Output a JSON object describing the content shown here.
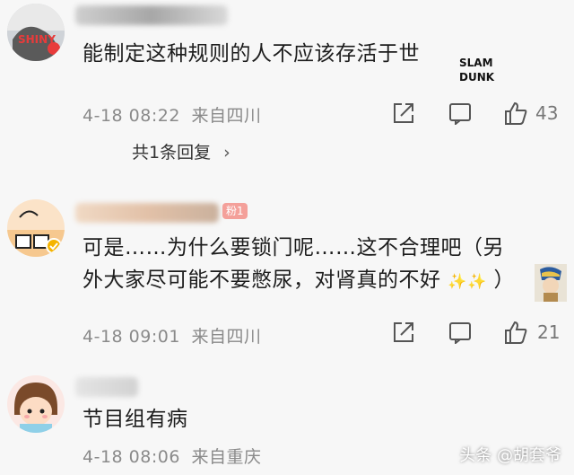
{
  "comments": [
    {
      "text": "能制定这种规则的人不应该存活于世",
      "timestamp": "4-18 08:22",
      "location": "来自四川",
      "likes": "43",
      "replies_label": "共1条回复",
      "sticker": "SLAM DUNK"
    },
    {
      "text_line1": "可是……为什么要锁门呢……这不合理吧（另",
      "text_line2": "外大家尽可能不要憋尿，对肾真的不好",
      "text_line2_end": "）",
      "timestamp": "4-18 09:01",
      "location": "来自四川",
      "likes": "21",
      "badge": "粉1"
    },
    {
      "text": "节目组有病",
      "timestamp": "4-18 08:06",
      "location": "来自重庆"
    }
  ],
  "watermark": "头条 @胡套爷",
  "colors": {
    "background": "#f7f7f7",
    "meta": "#8a8a8a",
    "text": "#1d1d1d"
  },
  "icons": [
    "share-icon",
    "comment-icon",
    "like-icon",
    "chevron-right-icon"
  ]
}
